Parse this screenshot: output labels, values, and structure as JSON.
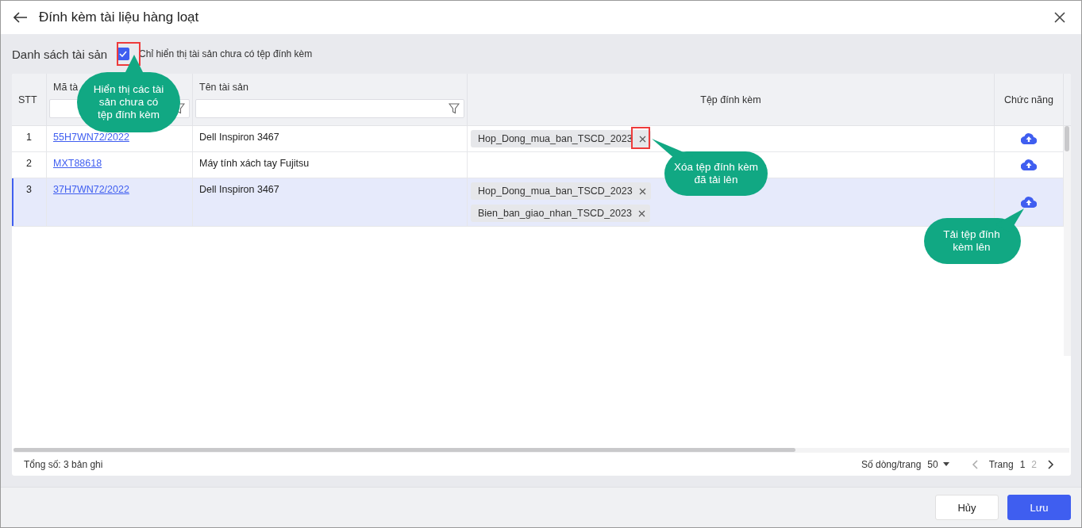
{
  "window": {
    "title": "Đính kèm tài liệu hàng loạt"
  },
  "section_title": "Danh sách tài sản",
  "filter_checkbox": {
    "label": "Chỉ hiển thị tài sản chưa có tệp đính kèm",
    "checked": true
  },
  "table": {
    "columns": [
      "STT",
      "Mã tà",
      "Tên tài sản",
      "Tệp đính kèm",
      "Chức năng"
    ],
    "rows": [
      {
        "stt": "1",
        "code": "55H7WN72/2022",
        "name": "Dell Inspiron 3467",
        "files": [
          "Hop_Dong_mua_ban_TSCD_2023"
        ],
        "selected": false
      },
      {
        "stt": "2",
        "code": "MXT88618",
        "name": "Máy tính xách tay Fujitsu",
        "files": [],
        "selected": false
      },
      {
        "stt": "3",
        "code": "37H7WN72/2022",
        "name": "Dell Inspiron 3467",
        "files": [
          "Hop_Dong_mua_ban_TSCD_2023",
          "Bien_ban_giao_nhan_TSCD_2023"
        ],
        "selected": true
      }
    ]
  },
  "footer": {
    "total": "Tổng số: 3 bản ghi",
    "page_size_label": "Số dòng/trang",
    "page_size": "50",
    "page_label": "Trang",
    "pages": [
      {
        "label": "1",
        "selected": true
      },
      {
        "label": "2",
        "selected": false
      }
    ]
  },
  "buttons": [
    {
      "label": "Hủy",
      "kind": "secondary"
    },
    {
      "label": "Lưu",
      "kind": "primary"
    }
  ],
  "callouts": [
    {
      "text": "Hiển thị các tài sản chưa có tệp đính kèm"
    },
    {
      "text": "Xóa tệp đính kèm đã tải lên"
    },
    {
      "text": "Tải tệp đính kèm lên"
    }
  ]
}
